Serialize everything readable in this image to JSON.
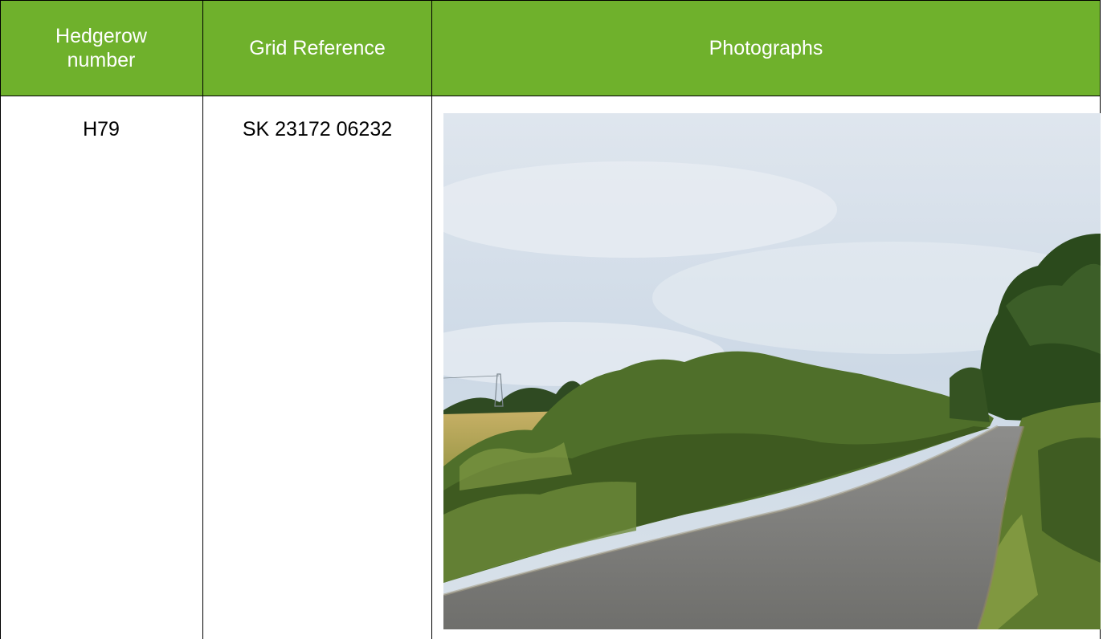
{
  "table": {
    "headers": {
      "col1_line1": "Hedgerow",
      "col1_line2": "number",
      "col2": "Grid Reference",
      "col3": "Photographs"
    },
    "rows": [
      {
        "hedgerow_number": "H79",
        "grid_reference": "SK 23172 06232"
      }
    ]
  },
  "colors": {
    "header_bg": "#6fb12c",
    "header_text": "#ffffff",
    "grid_line": "#000000"
  }
}
